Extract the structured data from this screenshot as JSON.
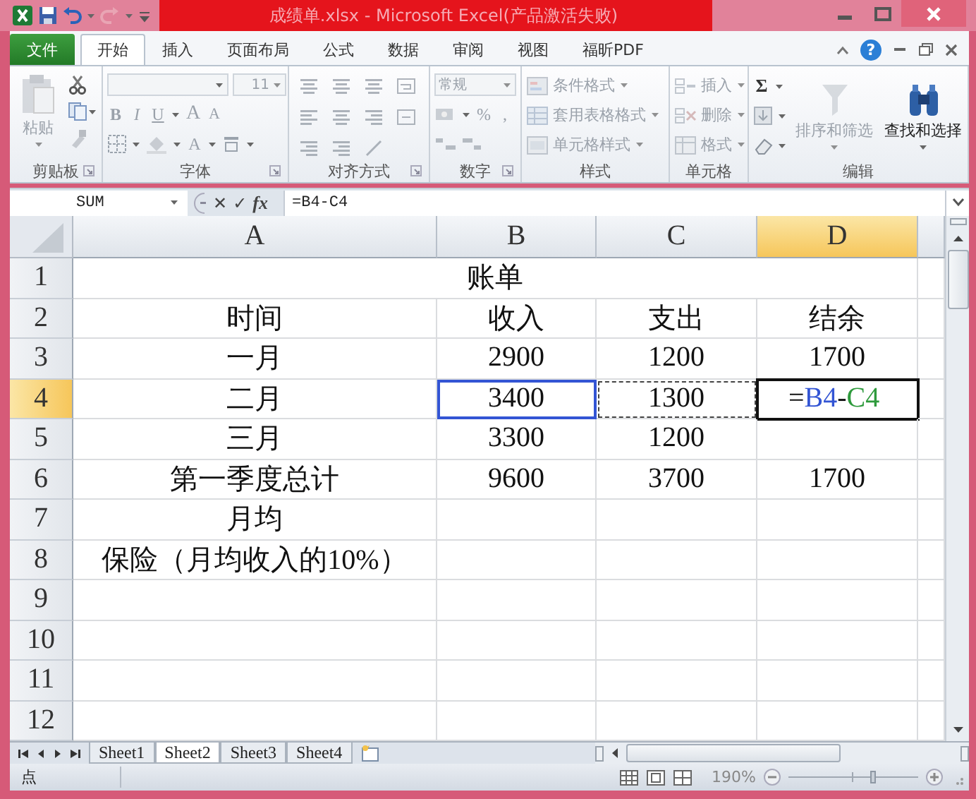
{
  "window": {
    "title": "成绩单.xlsx - Microsoft Excel(产品激活失败)"
  },
  "file_tab": {
    "label": "文件"
  },
  "tabs": [
    {
      "label": "开始",
      "selected": true
    },
    {
      "label": "插入",
      "selected": false
    },
    {
      "label": "页面布局",
      "selected": false
    },
    {
      "label": "公式",
      "selected": false
    },
    {
      "label": "数据",
      "selected": false
    },
    {
      "label": "审阅",
      "selected": false
    },
    {
      "label": "视图",
      "selected": false
    },
    {
      "label": "福昕PDF",
      "selected": false
    }
  ],
  "help": {
    "label": "?"
  },
  "ribbon": {
    "groups": [
      {
        "kind": "clipboard",
        "label": "剪贴板",
        "paste": {
          "label": "粘贴",
          "disabled": true
        }
      },
      {
        "kind": "font",
        "label": "字体",
        "size": "11",
        "disabled": true,
        "style_buttons": [
          "B",
          "I",
          "U"
        ],
        "grow": "A",
        "shrink": "A",
        "font_color": "A"
      },
      {
        "kind": "alignment",
        "label": "对齐方式",
        "disabled": true
      },
      {
        "kind": "number",
        "label": "数字",
        "format": "常规",
        "symbols": [
          "%",
          ","
        ],
        "disabled": true
      },
      {
        "kind": "styles",
        "label": "样式",
        "items": [
          {
            "label": "条件格式",
            "disabled": true
          },
          {
            "label": "套用表格格式",
            "disabled": true
          },
          {
            "label": "单元格样式",
            "disabled": true
          }
        ]
      },
      {
        "kind": "cells",
        "label": "单元格",
        "items": [
          {
            "label": "插入",
            "disabled": true
          },
          {
            "label": "删除",
            "disabled": true
          },
          {
            "label": "格式",
            "disabled": true
          }
        ]
      },
      {
        "kind": "editing",
        "label": "编辑",
        "sum": {
          "label": "Σ",
          "disabled": false
        },
        "large": [
          {
            "label": "排序和筛选",
            "disabled": true
          },
          {
            "label": "查找和选择",
            "disabled": false
          }
        ]
      }
    ]
  },
  "formula_bar": {
    "name_box": "SUM",
    "cancel": "✕",
    "enter": "✓",
    "function": "fx",
    "formula": "=B4-C4"
  },
  "sheet": {
    "columns": [
      {
        "label": "A",
        "selected": false
      },
      {
        "label": "B",
        "selected": false
      },
      {
        "label": "C",
        "selected": false
      },
      {
        "label": "D",
        "selected": true
      }
    ],
    "rows": [
      {
        "label": "1",
        "selected": false,
        "kind": "merged",
        "cells": {
          "A": "账单"
        }
      },
      {
        "label": "2",
        "selected": false,
        "kind": "plain",
        "cells": {
          "A": "时间",
          "B": "收入",
          "C": "支出",
          "D": "结余"
        }
      },
      {
        "label": "3",
        "selected": false,
        "kind": "plain",
        "cells": {
          "A": "一月",
          "B": "2900",
          "C": "1200",
          "D": "1700"
        }
      },
      {
        "label": "4",
        "selected": true,
        "kind": "plain",
        "cells": {
          "A": "二月",
          "B": {
            "text": "3400",
            "kind": "reference",
            "color": "#3355d4"
          },
          "C": {
            "text": "1300",
            "kind": "copy"
          },
          "D": {
            "kind": "edit",
            "tokens": [
              {
                "text": "="
              },
              {
                "text": "B4",
                "color": "#3355d4"
              },
              {
                "text": "-"
              },
              {
                "text": "C4",
                "color": "#2e9a3c"
              }
            ]
          }
        }
      },
      {
        "label": "5",
        "selected": false,
        "kind": "plain",
        "cells": {
          "A": "三月",
          "B": "3300",
          "C": "1200"
        }
      },
      {
        "label": "6",
        "selected": false,
        "kind": "plain",
        "cells": {
          "A": "第一季度总计",
          "B": "9600",
          "C": "3700",
          "D": "1700"
        }
      },
      {
        "label": "7",
        "selected": false,
        "kind": "plain",
        "cells": {
          "A": "月均"
        }
      },
      {
        "label": "8",
        "selected": false,
        "kind": "plain",
        "cells": {
          "A": "保险（月均收入的10%）"
        }
      },
      {
        "label": "9",
        "selected": false,
        "kind": "plain",
        "cells": {}
      },
      {
        "label": "10",
        "selected": false,
        "kind": "plain",
        "cells": {}
      },
      {
        "label": "11",
        "selected": false,
        "kind": "plain",
        "cells": {}
      },
      {
        "label": "12",
        "selected": false,
        "kind": "plain",
        "cells": {}
      }
    ]
  },
  "sheet_tabs": [
    {
      "label": "Sheet1",
      "selected": false
    },
    {
      "label": "Sheet2",
      "selected": true
    },
    {
      "label": "Sheet3",
      "selected": false
    },
    {
      "label": "Sheet4",
      "selected": false
    }
  ],
  "status_bar": {
    "mode": "点",
    "zoom": "190%",
    "zoom_slider": {
      "level": 0.65
    }
  }
}
